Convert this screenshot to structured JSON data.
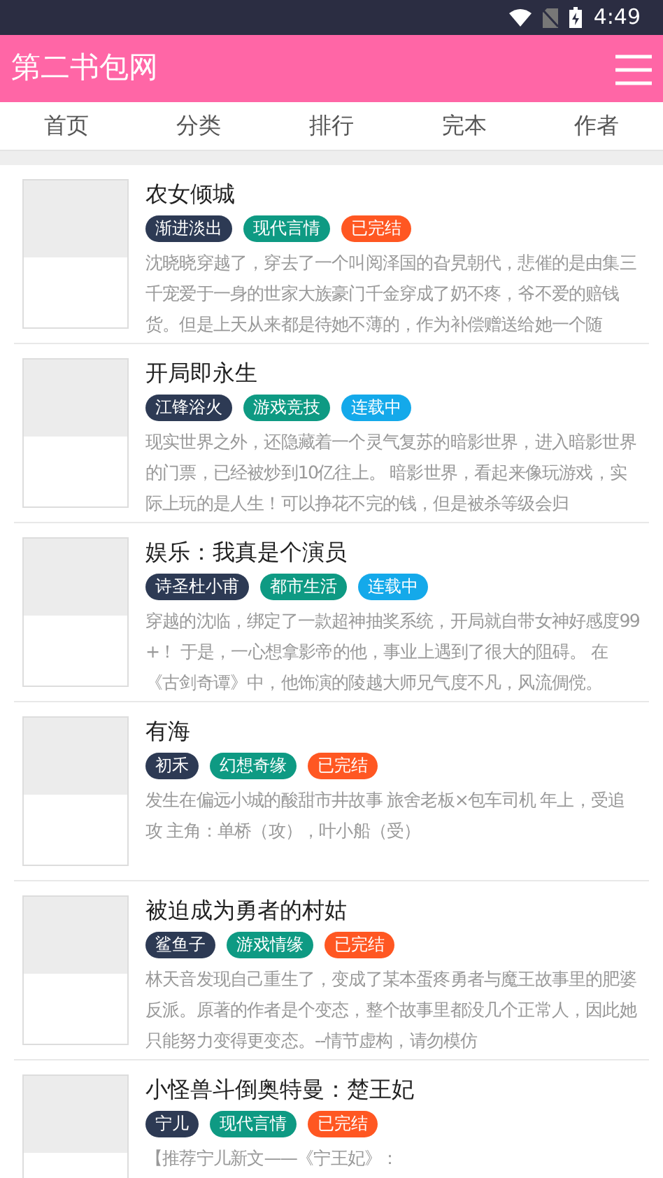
{
  "status_bar": {
    "time": "4:49"
  },
  "header": {
    "title": "第二书包网"
  },
  "tabs": [
    {
      "label": "首页",
      "selected": false
    },
    {
      "label": "分类",
      "selected": false
    },
    {
      "label": "排行",
      "selected": false
    },
    {
      "label": "完本",
      "selected": false
    },
    {
      "label": "作者",
      "selected": false
    }
  ],
  "books": [
    {
      "title": "农女倾城",
      "tags": [
        {
          "text": "渐进淡出",
          "color": "#2d3a54"
        },
        {
          "text": "现代言情",
          "color": "#0e9a83"
        },
        {
          "text": "已完结",
          "color": "#ff5722"
        }
      ],
      "description": "沈晓晓穿越了，穿去了一个叫阅泽国的旮旯朝代，悲催的是由集三千宠爱于一身的世家大族豪门千金穿成了奶不疼，爷不爱的赔钱货。但是上天从来都是待她不薄的，作为补偿赠送给她一个随"
    },
    {
      "title": "开局即永生",
      "tags": [
        {
          "text": "江锋浴火",
          "color": "#2d3a54"
        },
        {
          "text": "游戏竞技",
          "color": "#0e9a83"
        },
        {
          "text": "连载中",
          "color": "#14a9ea"
        }
      ],
      "description": "现实世界之外，还隐藏着一个灵气复苏的暗影世界，进入暗影世界的门票，已经被炒到10亿往上。 暗影世界，看起来像玩游戏，实际上玩的是人生！可以挣花不完的钱，但是被杀等级会归"
    },
    {
      "title": "娱乐：我真是个演员",
      "tags": [
        {
          "text": "诗圣杜小甫",
          "color": "#2d3a54"
        },
        {
          "text": "都市生活",
          "color": "#0e9a83"
        },
        {
          "text": "连载中",
          "color": "#14a9ea"
        }
      ],
      "description": "穿越的沈临，绑定了一款超神抽奖系统，开局就自带女神好感度99+！ 于是，一心想拿影帝的他，事业上遇到了很大的阻碍。 在《古剑奇谭》中，他饰演的陵越大师兄气度不凡，风流倜傥。"
    },
    {
      "title": "有海",
      "tags": [
        {
          "text": "初禾",
          "color": "#2d3a54"
        },
        {
          "text": "幻想奇缘",
          "color": "#0e9a83"
        },
        {
          "text": "已完结",
          "color": "#ff5722"
        }
      ],
      "description": "发生在偏远小城的酸甜市井故事 旅舍老板×包车司机 年上，受追攻 主角：单桥（攻），叶小船（受）"
    },
    {
      "title": "被迫成为勇者的村姑",
      "tags": [
        {
          "text": "鲨鱼子",
          "color": "#2d3a54"
        },
        {
          "text": "游戏情缘",
          "color": "#0e9a83"
        },
        {
          "text": "已完结",
          "color": "#ff5722"
        }
      ],
      "description": "林天音发现自己重生了，变成了某本蛋疼勇者与魔王故事里的肥婆反派。原著的作者是个变态，整个故事里都没几个正常人，因此她只能努力变得更变态。--情节虚构，请勿模仿"
    },
    {
      "title": "小怪兽斗倒奥特曼：楚王妃",
      "tags": [
        {
          "text": "宁儿",
          "color": "#2d3a54"
        },
        {
          "text": "现代言情",
          "color": "#0e9a83"
        },
        {
          "text": "已完结",
          "color": "#ff5722"
        }
      ],
      "description": "【推荐宁儿新文——《宁王妃》："
    }
  ]
}
